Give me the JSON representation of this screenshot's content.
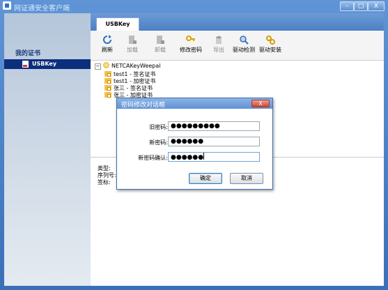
{
  "window": {
    "title": "网证通安全客户端",
    "controls": {
      "minimize": "–",
      "maximize": "□",
      "close": "X"
    }
  },
  "sidebar": {
    "title": "我的证书",
    "items": [
      {
        "label": "USBKey",
        "icon": "document-icon"
      }
    ]
  },
  "tabs": [
    {
      "label": "USBKey"
    }
  ],
  "toolbar": {
    "refresh": "刷新",
    "load": "加载",
    "unload": "卸载",
    "change_password": "修改密码",
    "export": "导出",
    "driver_check": "驱动检测",
    "driver_install": "驱动安装"
  },
  "tree": {
    "root": "NETCAKeyWeepal",
    "children": [
      "test1 - 签名证书",
      "test1 - 加密证书",
      "张三 - 签名证书",
      "张三 - 加密证书"
    ]
  },
  "details": {
    "type_label": "类型:",
    "serial_label": "序列号:",
    "issuer_label": "签标:"
  },
  "dialog": {
    "title": "密码修改对话框",
    "close": "X",
    "old_password_label": "旧密码:",
    "old_password_value": "●●●●●●●●●",
    "new_password_label": "新密码:",
    "new_password_value": "●●●●●●",
    "confirm_label": "新密码确认:",
    "confirm_value": "●●●●●●",
    "ok": "确定",
    "cancel": "取消"
  }
}
